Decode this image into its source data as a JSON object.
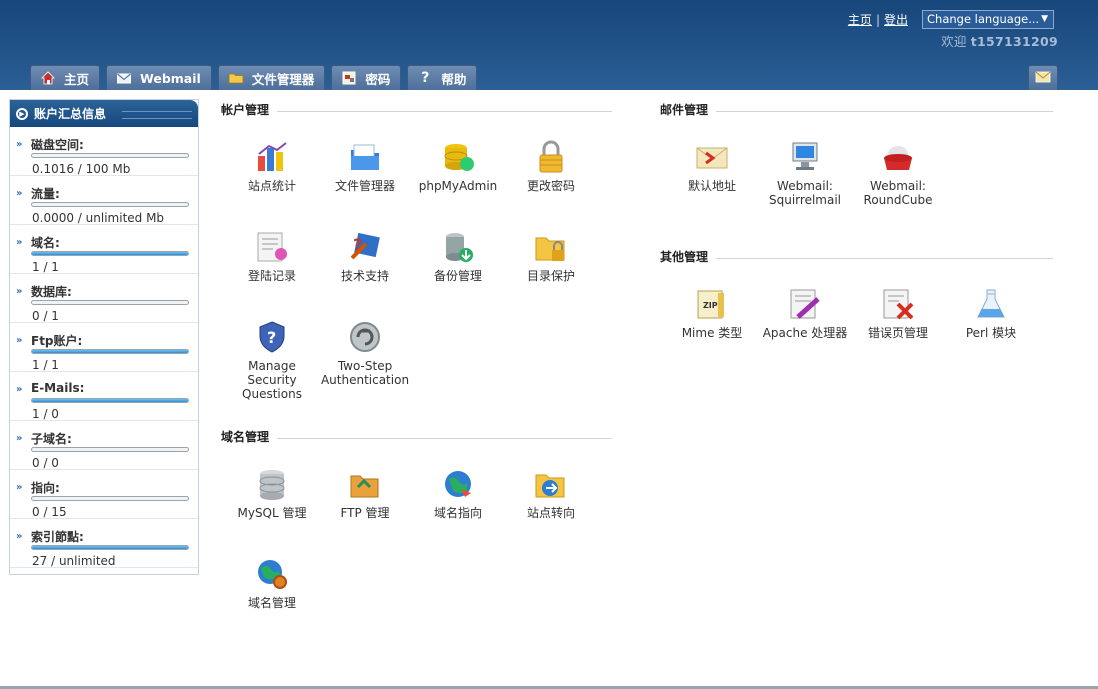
{
  "header": {
    "home_link": "主页",
    "logout_link": "登出",
    "language_select": "Change language...",
    "welcome_label": "欢迎",
    "username": "t157131209"
  },
  "tabs": [
    {
      "label": "主页",
      "icon": "home-icon"
    },
    {
      "label": "Webmail",
      "icon": "mail-icon"
    },
    {
      "label": "文件管理器",
      "icon": "folder-icon"
    },
    {
      "label": "密码",
      "icon": "key-icon"
    },
    {
      "label": "帮助",
      "icon": "help-icon"
    }
  ],
  "sidebar": {
    "title": "账户汇总信息",
    "stats": [
      {
        "label": "磁盘空间:",
        "value": "0.1016 / 100 Mb",
        "fill": 0.001
      },
      {
        "label": "流量:",
        "value": "0.0000 / unlimited Mb",
        "fill": 0
      },
      {
        "label": "域名:",
        "value": "1 / 1",
        "fill": 1
      },
      {
        "label": "数据库:",
        "value": "0 / 1",
        "fill": 0
      },
      {
        "label": "Ftp账户:",
        "value": "1 / 1",
        "fill": 1
      },
      {
        "label": "E-Mails:",
        "value": "1 / 0",
        "fill": 1
      },
      {
        "label": "子域名:",
        "value": "0 / 0",
        "fill": 0
      },
      {
        "label": "指向:",
        "value": "0 / 15",
        "fill": 0
      },
      {
        "label": "索引節點:",
        "value": "27 / unlimited",
        "fill": 1
      }
    ]
  },
  "sections": {
    "account": {
      "title": "帐户管理",
      "items": [
        {
          "label": "站点统计",
          "icon": "site-stats-icon"
        },
        {
          "label": "文件管理器",
          "icon": "file-manager-icon"
        },
        {
          "label": "phpMyAdmin",
          "icon": "phpmyadmin-icon"
        },
        {
          "label": "更改密码",
          "icon": "lock-icon"
        },
        {
          "label": "登陆记录",
          "icon": "login-log-icon"
        },
        {
          "label": "技术支持",
          "icon": "support-icon"
        },
        {
          "label": "备份管理",
          "icon": "backup-icon"
        },
        {
          "label": "目录保护",
          "icon": "folder-lock-icon"
        },
        {
          "label": "Manage Security Questions",
          "icon": "security-shield-icon"
        },
        {
          "label": "Two-Step Authentication",
          "icon": "two-step-icon"
        }
      ]
    },
    "domain": {
      "title": "域名管理",
      "items": [
        {
          "label": "MySQL 管理",
          "icon": "database-icon"
        },
        {
          "label": "FTP 管理",
          "icon": "ftp-folder-icon"
        },
        {
          "label": "域名指向",
          "icon": "domain-pointer-icon"
        },
        {
          "label": "站点转向",
          "icon": "redirect-icon"
        },
        {
          "label": "域名管理",
          "icon": "globe-gear-icon"
        }
      ]
    },
    "mail": {
      "title": "邮件管理",
      "items": [
        {
          "label": "默认地址",
          "icon": "default-address-icon"
        },
        {
          "label": "Webmail: Squirrelmail",
          "icon": "squirrelmail-icon"
        },
        {
          "label": "Webmail: RoundCube",
          "icon": "roundcube-icon"
        }
      ]
    },
    "other": {
      "title": "其他管理",
      "items": [
        {
          "label": "Mime 类型",
          "icon": "mime-icon"
        },
        {
          "label": "Apache 处理器",
          "icon": "apache-handler-icon"
        },
        {
          "label": "错误页管理",
          "icon": "error-page-icon"
        },
        {
          "label": "Perl 模块",
          "icon": "perl-module-icon"
        }
      ]
    }
  }
}
